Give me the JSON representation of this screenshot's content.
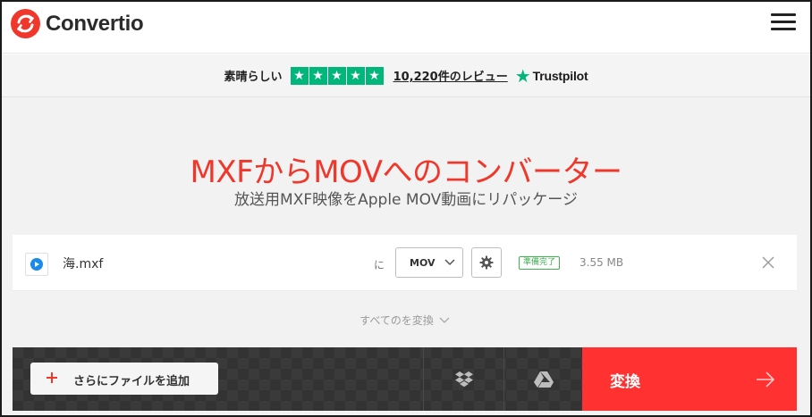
{
  "header": {
    "logo_text": "Convertio",
    "brand_color": "#f0372c"
  },
  "rating": {
    "text": "素晴らしい",
    "stars": [
      "★",
      "★",
      "★",
      "★",
      "★"
    ],
    "reviews_link": "10,220件のレビュー",
    "trustpilot_star": "★",
    "trustpilot_label": "Trustpilot",
    "star_color": "#00b67a"
  },
  "hero": {
    "title": "MXFからMOVへのコンバーター",
    "subtitle": "放送用MXF映像をApple MOV動画にリパッケージ"
  },
  "file": {
    "icon": "play-icon",
    "name": "海.mxf",
    "to_label": "に",
    "format": "MOV",
    "status": "準備完了",
    "size": "3.55 MB"
  },
  "convert_all": {
    "label": "すべてのを変換"
  },
  "bottom": {
    "add_files_label": "さらにファイルを追加",
    "convert_label": "変換",
    "convert_color": "#ff3131"
  }
}
